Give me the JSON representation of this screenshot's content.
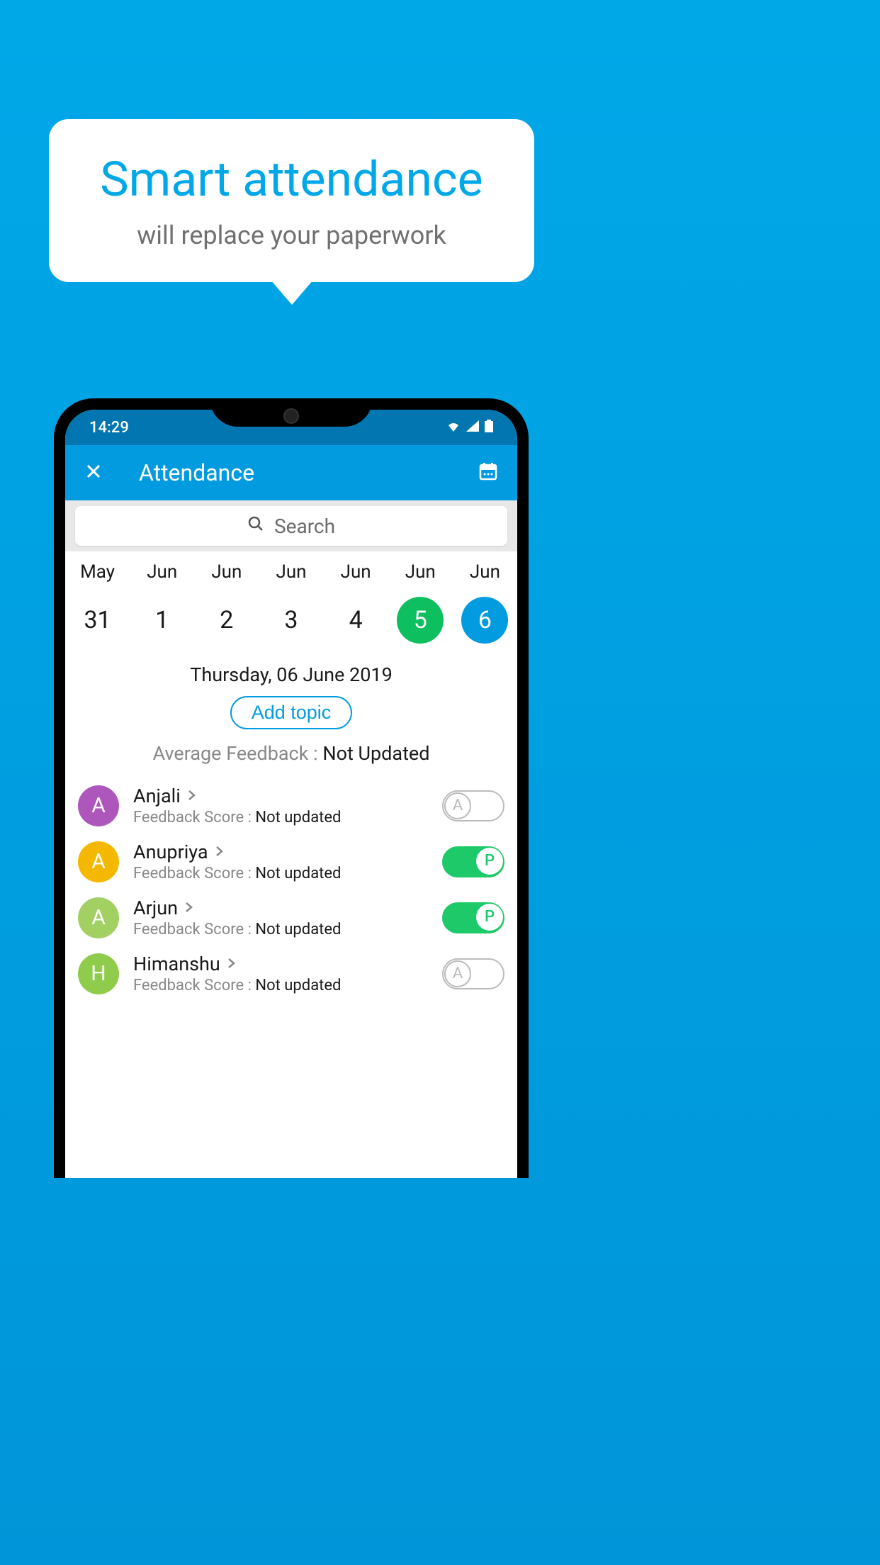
{
  "promo": {
    "title": "Smart attendance",
    "subtitle": "will replace your paperwork"
  },
  "status": {
    "time": "14:29"
  },
  "header": {
    "title": "Attendance"
  },
  "search": {
    "placeholder": "Search"
  },
  "dates": [
    {
      "month": "May",
      "day": "31",
      "style": ""
    },
    {
      "month": "Jun",
      "day": "1",
      "style": ""
    },
    {
      "month": "Jun",
      "day": "2",
      "style": ""
    },
    {
      "month": "Jun",
      "day": "3",
      "style": ""
    },
    {
      "month": "Jun",
      "day": "4",
      "style": ""
    },
    {
      "month": "Jun",
      "day": "5",
      "style": "green"
    },
    {
      "month": "Jun",
      "day": "6",
      "style": "blue"
    }
  ],
  "fullDate": "Thursday, 06 June 2019",
  "addTopic": "Add topic",
  "averageFeedback": {
    "label": "Average Feedback : ",
    "value": "Not Updated"
  },
  "students": [
    {
      "initial": "A",
      "color": "purple",
      "name": "Anjali",
      "fbLabel": "Feedback Score : ",
      "fbValue": "Not updated",
      "toggleOn": false,
      "toggleLetter": "A"
    },
    {
      "initial": "A",
      "color": "yellow",
      "name": "Anupriya",
      "fbLabel": "Feedback Score : ",
      "fbValue": "Not updated",
      "toggleOn": true,
      "toggleLetter": "P"
    },
    {
      "initial": "A",
      "color": "lime",
      "name": "Arjun",
      "fbLabel": "Feedback Score : ",
      "fbValue": "Not updated",
      "toggleOn": true,
      "toggleLetter": "P"
    },
    {
      "initial": "H",
      "color": "green",
      "name": "Himanshu",
      "fbLabel": "Feedback Score : ",
      "fbValue": "Not updated",
      "toggleOn": false,
      "toggleLetter": "A"
    }
  ]
}
